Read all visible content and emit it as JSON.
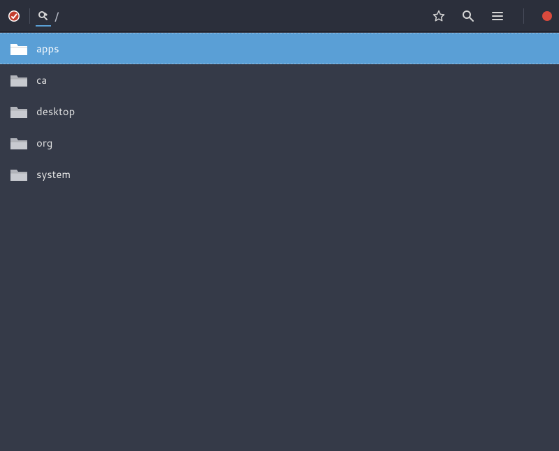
{
  "header": {
    "breadcrumb_path": "/",
    "app_icon": "dconf-editor-icon",
    "tool_icon": "search-edit-icon"
  },
  "folders": [
    {
      "name": "apps",
      "selected": true
    },
    {
      "name": "ca",
      "selected": false
    },
    {
      "name": "desktop",
      "selected": false
    },
    {
      "name": "org",
      "selected": false
    },
    {
      "name": "system",
      "selected": false
    }
  ],
  "icons": {
    "star": "star-icon",
    "search": "search-icon",
    "hamburger": "hamburger-icon",
    "close": "close-dot"
  }
}
